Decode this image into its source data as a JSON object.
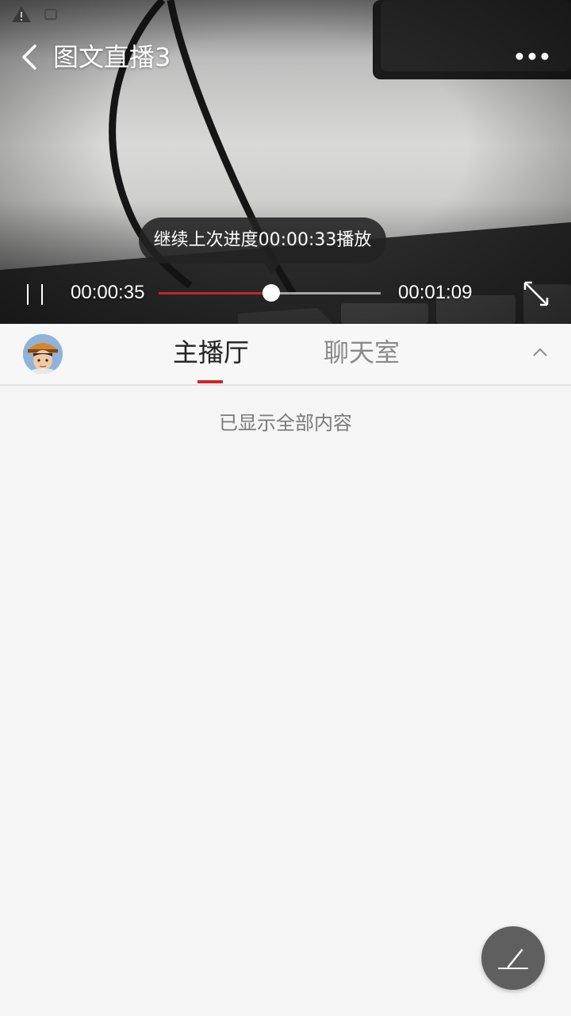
{
  "header": {
    "title": "图文直播3"
  },
  "player": {
    "resume_tooltip": "继续上次进度00:00:33播放",
    "current_time": "00:00:35",
    "total_time": "00:01:09",
    "progress": 0.507,
    "accent_color": "#c0272d"
  },
  "tabs": [
    {
      "label": "主播厅",
      "active": true
    },
    {
      "label": "聊天室",
      "active": false
    }
  ],
  "content": {
    "end_message": "已显示全部内容"
  },
  "icons": {
    "back": "chevron-left-icon",
    "more": "more-dots-icon",
    "pause": "pause-icon",
    "fullscreen": "fullscreen-icon",
    "collapse": "chevron-up-icon",
    "compose": "pencil-icon"
  }
}
